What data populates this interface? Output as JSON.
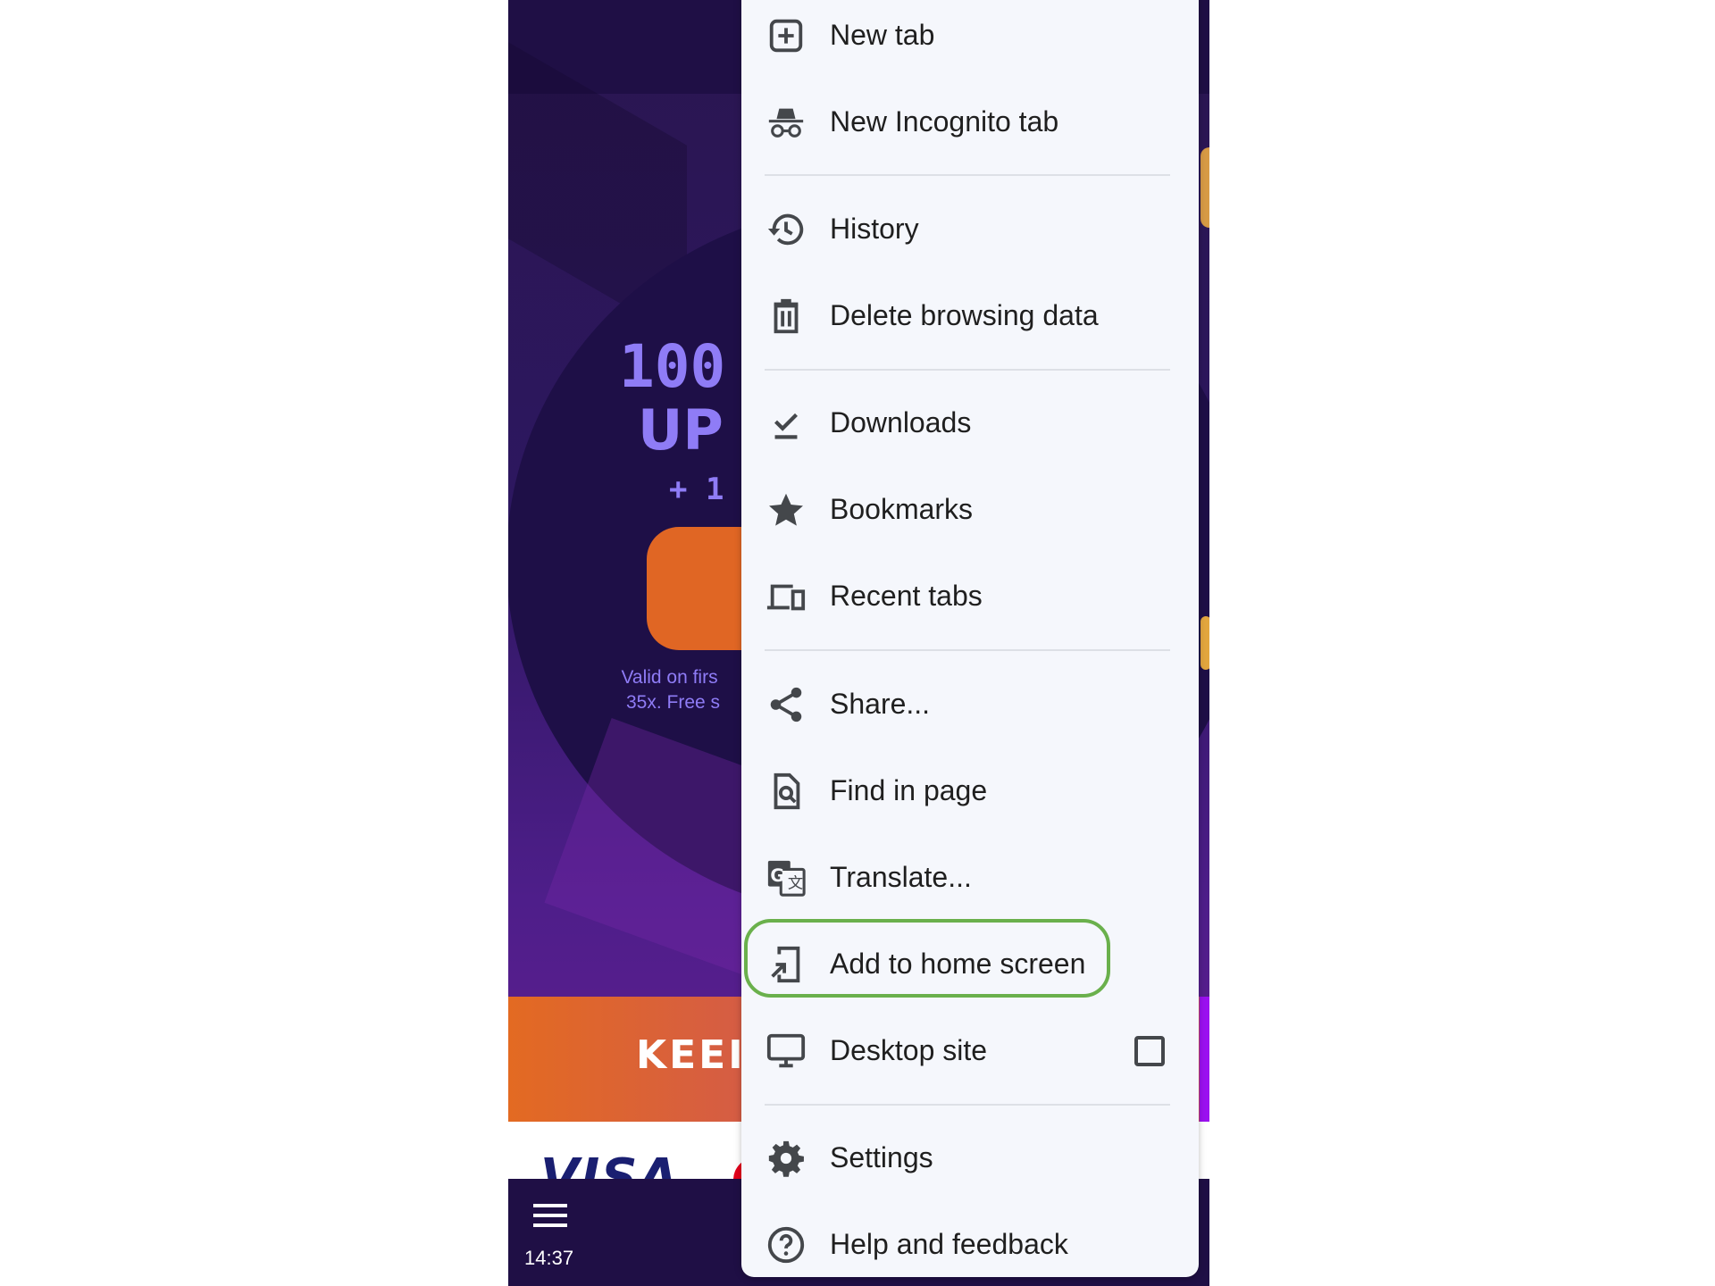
{
  "page": {
    "promo_headline": "100",
    "promo_headline_2": "UP",
    "promo_extra": "+ 1",
    "promo_terms_line1": "Valid on firs",
    "promo_terms_line2": "35x. Free s",
    "banner_text": "KEEI",
    "payment_logo": "VISA",
    "menu_icon": "hamburger-icon",
    "time": "14:37"
  },
  "menu": {
    "highlight_color": "#6ab04c",
    "items": [
      {
        "label": "New tab",
        "icon": "new-tab-icon"
      },
      {
        "label": "New Incognito tab",
        "icon": "incognito-icon"
      },
      {
        "label": "History",
        "icon": "history-icon"
      },
      {
        "label": "Delete browsing data",
        "icon": "trash-icon"
      },
      {
        "label": "Downloads",
        "icon": "download-done-icon"
      },
      {
        "label": "Bookmarks",
        "icon": "star-icon"
      },
      {
        "label": "Recent tabs",
        "icon": "devices-icon"
      },
      {
        "label": "Share...",
        "icon": "share-icon"
      },
      {
        "label": "Find in page",
        "icon": "find-in-page-icon"
      },
      {
        "label": "Translate...",
        "icon": "translate-icon"
      },
      {
        "label": "Add to home screen",
        "icon": "add-to-home-screen-icon",
        "highlighted": true
      },
      {
        "label": "Desktop site",
        "icon": "desktop-icon",
        "checkbox": false
      },
      {
        "label": "Settings",
        "icon": "gear-icon"
      },
      {
        "label": "Help and feedback",
        "icon": "help-icon"
      }
    ]
  }
}
